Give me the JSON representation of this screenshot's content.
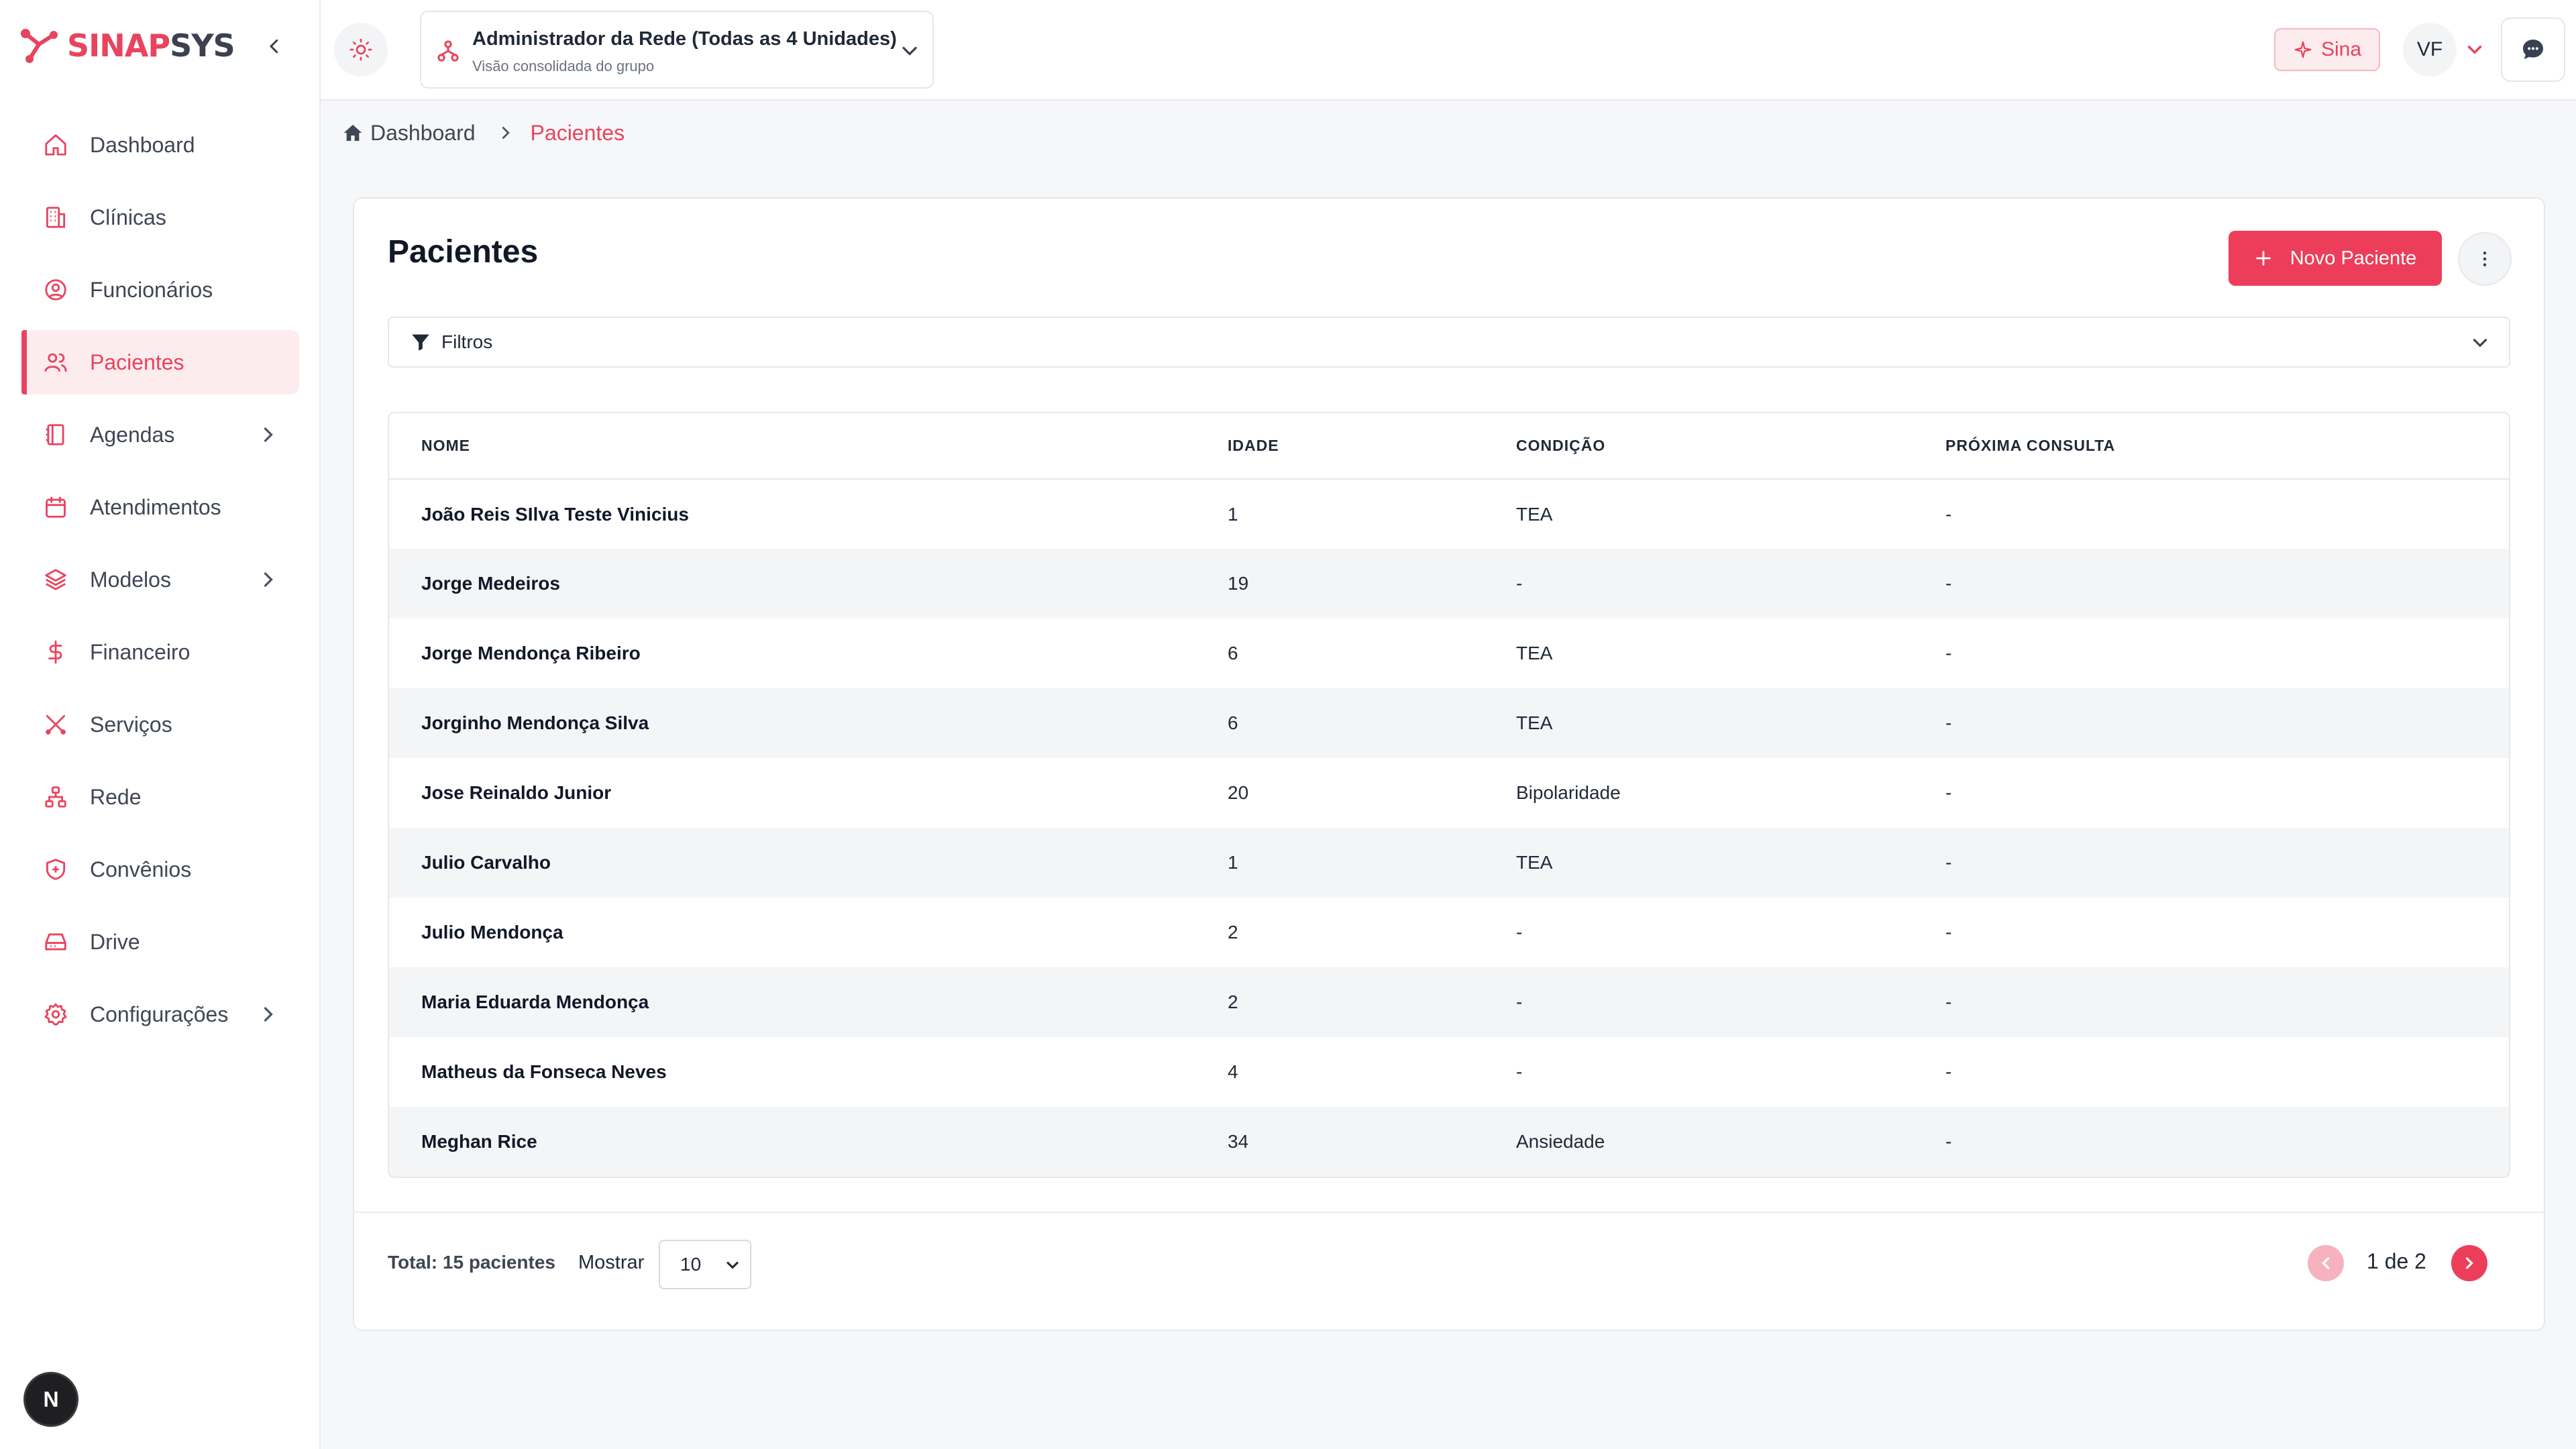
{
  "brand": {
    "name_part1": "SINAP",
    "name_part2": "SYS",
    "accent": "#e8445e"
  },
  "sidebar": {
    "items": [
      {
        "label": "Dashboard",
        "icon": "home-icon"
      },
      {
        "label": "Clínicas",
        "icon": "building-icon"
      },
      {
        "label": "Funcionários",
        "icon": "user-circle-icon"
      },
      {
        "label": "Pacientes",
        "icon": "users-icon",
        "active": true
      },
      {
        "label": "Agendas",
        "icon": "book-icon",
        "expandable": true
      },
      {
        "label": "Atendimentos",
        "icon": "calendar-icon"
      },
      {
        "label": "Modelos",
        "icon": "layers-icon",
        "expandable": true
      },
      {
        "label": "Financeiro",
        "icon": "dollar-icon"
      },
      {
        "label": "Serviços",
        "icon": "scissors-icon"
      },
      {
        "label": "Rede",
        "icon": "network-icon"
      },
      {
        "label": "Convênios",
        "icon": "shield-icon"
      },
      {
        "label": "Drive",
        "icon": "drive-icon"
      },
      {
        "label": "Configurações",
        "icon": "gear-icon",
        "expandable": true
      }
    ],
    "badge": "N"
  },
  "header": {
    "org_title": "Administrador da Rede (Todas as 4 Unidades)",
    "org_subtitle": "Visão consolidada do grupo",
    "sina_label": "Sina",
    "user_initials": "VF"
  },
  "breadcrumb": {
    "home": "Dashboard",
    "current": "Pacientes"
  },
  "page": {
    "title": "Pacientes",
    "new_button": "Novo Paciente",
    "filters_label": "Filtros"
  },
  "table": {
    "columns": [
      "Nome",
      "Idade",
      "Condição",
      "Próxima Consulta"
    ],
    "rows": [
      {
        "name": "João Reis SIlva Teste Vinicius",
        "age": "1",
        "condition": "TEA",
        "next": "-"
      },
      {
        "name": "Jorge Medeiros",
        "age": "19",
        "condition": "-",
        "next": "-"
      },
      {
        "name": "Jorge Mendonça Ribeiro",
        "age": "6",
        "condition": "TEA",
        "next": "-"
      },
      {
        "name": "Jorginho Mendonça Silva",
        "age": "6",
        "condition": "TEA",
        "next": "-"
      },
      {
        "name": "Jose Reinaldo Junior",
        "age": "20",
        "condition": "Bipolaridade",
        "next": "-"
      },
      {
        "name": "Julio Carvalho",
        "age": "1",
        "condition": "TEA",
        "next": "-"
      },
      {
        "name": "Julio Mendonça",
        "age": "2",
        "condition": "-",
        "next": "-"
      },
      {
        "name": "Maria Eduarda Mendonça",
        "age": "2",
        "condition": "-",
        "next": "-"
      },
      {
        "name": "Matheus da Fonseca Neves",
        "age": "4",
        "condition": "-",
        "next": "-"
      },
      {
        "name": "Meghan Rice",
        "age": "34",
        "condition": "Ansiedade",
        "next": "-"
      }
    ]
  },
  "footer": {
    "total": "Total: 15 pacientes",
    "show_label": "Mostrar",
    "page_size": "10",
    "pagination": "1 de 2"
  }
}
